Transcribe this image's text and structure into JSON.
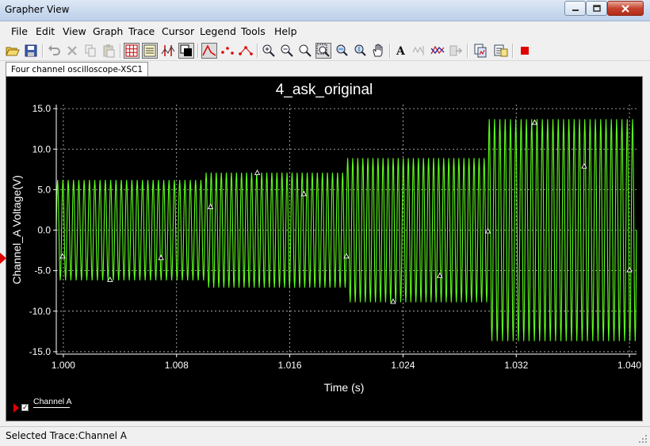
{
  "window": {
    "title": "Grapher View",
    "buttons": {
      "minimize": "minimize-icon",
      "maximize": "maximize-icon",
      "close": "close-icon"
    }
  },
  "menu": [
    "File",
    "Edit",
    "View",
    "Graph",
    "Trace",
    "Cursor",
    "Legend",
    "Tools",
    "Help"
  ],
  "toolbar": {
    "icons": [
      "open-icon",
      "save-icon",
      "undo-icon",
      "delete-icon",
      "copy-icon",
      "paste-icon",
      "grid-icon",
      "legend-icon",
      "cursors-icon",
      "reverse-colors-icon",
      "show-lines-icon",
      "show-points-icon",
      "lines-and-points-icon",
      "zoom-in-icon",
      "zoom-out-icon",
      "zoom-fit-icon",
      "zoom-area-icon",
      "zoom-x-icon",
      "zoom-y-icon",
      "pan-icon",
      "title-icon",
      "select-marks-icon",
      "overlay-icon",
      "export-icon",
      "copy-graph-icon",
      "properties-icon",
      "stop-icon"
    ]
  },
  "tab": {
    "label": "Four channel oscilloscope-XSC1"
  },
  "legend": {
    "label": "Channel A",
    "checked": true
  },
  "status": {
    "text": "Selected Trace:Channel A"
  },
  "colors": {
    "plot_background": "#000000",
    "trace": "#5dff1c",
    "grid": "#c8c8c8",
    "text": "#ffffff",
    "marker": "#e00000"
  },
  "chart_data": {
    "type": "line",
    "title": "4_ask_original",
    "xlabel": "Time (s)",
    "ylabel": "Channel_A Voltage(V)",
    "xlim": [
      0.9995,
      1.0405
    ],
    "ylim": [
      -15.3,
      15.5
    ],
    "x_ticks": [
      "1.000",
      "1.008",
      "1.016",
      "1.024",
      "1.032",
      "1.040"
    ],
    "y_ticks": [
      "15.0",
      "10.0",
      "5.0",
      "0.0",
      "-5.0",
      "-10.0",
      "-15.0"
    ],
    "grid": true,
    "legend_position": "bottom-left",
    "series": [
      {
        "name": "Channel A",
        "waveform": "sine bursts (amplitude shift keying)",
        "x_start": 0.9995,
        "x_end": 1.0405,
        "cycles_per_segment": 28,
        "segments": [
          {
            "t_start": 0.9995,
            "t_end": 1.01,
            "amplitude": 6.2
          },
          {
            "t_start": 1.01,
            "t_end": 1.02,
            "amplitude": 7.1
          },
          {
            "t_start": 1.02,
            "t_end": 1.03,
            "amplitude": 8.9
          },
          {
            "t_start": 1.03,
            "t_end": 1.0405,
            "amplitude": 13.7
          }
        ]
      }
    ],
    "markers": [
      {
        "x": 0.99995,
        "y": -3.2
      },
      {
        "x": 1.0033,
        "y": -6.1
      },
      {
        "x": 1.0069,
        "y": -3.4
      },
      {
        "x": 1.0104,
        "y": 2.9
      },
      {
        "x": 1.0137,
        "y": 7.1
      },
      {
        "x": 1.017,
        "y": 4.5
      },
      {
        "x": 1.02,
        "y": -3.2
      },
      {
        "x": 1.0233,
        "y": -8.8
      },
      {
        "x": 1.0266,
        "y": -5.6
      },
      {
        "x": 1.03,
        "y": -0.1
      },
      {
        "x": 1.0333,
        "y": 13.3
      },
      {
        "x": 1.0368,
        "y": 7.9
      },
      {
        "x": 1.04,
        "y": -4.9
      }
    ]
  }
}
